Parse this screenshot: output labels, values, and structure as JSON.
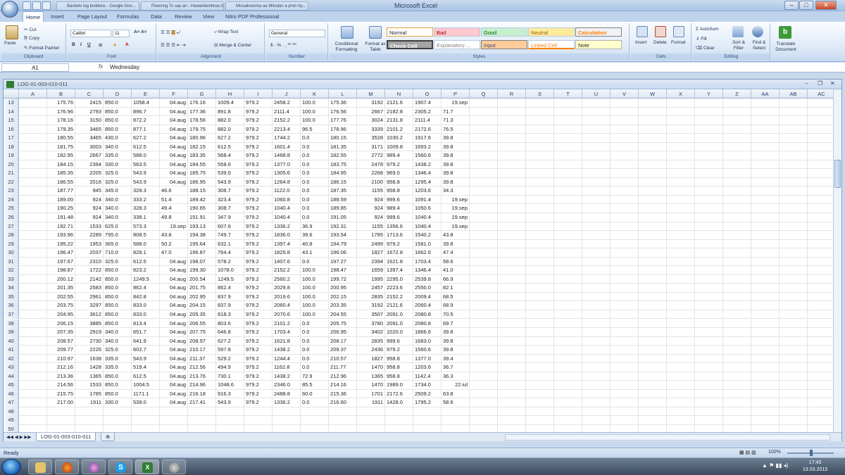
{
  "window": {
    "title": "Microsoft Excel"
  },
  "bg_tabs": [
    "Baskets log buildens - Google Goo...",
    "Planning To say an - Hawaiiskmitnas b...",
    "Mosaikvevina aa Mitodan a pron hp..."
  ],
  "ribbon_tabs": [
    "Home",
    "Insert",
    "Page Layout",
    "Formulas",
    "Data",
    "Review",
    "View",
    "Nitro PDF Professional"
  ],
  "ribbon": {
    "clipboard": {
      "label": "Clipboard",
      "paste": "Paste",
      "cut": "Cut",
      "copy": "Copy",
      "format_painter": "Format Painter"
    },
    "font": {
      "label": "Font",
      "name": "Calibri",
      "size": "11"
    },
    "alignment": {
      "label": "Alignment",
      "wrap": "Wrap Text",
      "merge": "Merge & Center"
    },
    "number": {
      "label": "Number",
      "format": "General"
    },
    "styles": {
      "label": "Styles",
      "conditional": "Conditional Formatting",
      "format_table": "Format as Table",
      "cells": [
        "Normal",
        "Bad",
        "Good",
        "Neutral",
        "Calculation",
        "Check Cell",
        "Explanatory ...",
        "Input",
        "Linked Cell",
        "Note"
      ]
    },
    "cells": {
      "label": "Cells",
      "insert": "Insert",
      "delete": "Delete",
      "format": "Format"
    },
    "editing": {
      "label": "Editing",
      "autosum": "AutoSum",
      "fill": "Fill",
      "clear": "Clear",
      "sort": "Sort & Filter",
      "find": "Find & Select"
    },
    "translate": {
      "label": "Translate Document"
    }
  },
  "formula_bar": {
    "name_box": "A1",
    "fx": "fx",
    "value": "Wednesday"
  },
  "workbook": {
    "title": "LOG-01-003-010-011",
    "sheet_tab": "LOG-01-003-010-011"
  },
  "columns": [
    "A",
    "B",
    "C",
    "D",
    "E",
    "F",
    "G",
    "H",
    "I",
    "J",
    "K",
    "L",
    "M",
    "N",
    "O",
    "P",
    "Q",
    "R",
    "S",
    "T",
    "U",
    "V",
    "W",
    "X",
    "Y",
    "Z",
    "AA",
    "AB",
    "AC"
  ],
  "rows": [
    {
      "n": "13",
      "c": [
        "",
        "175.76",
        "2415",
        "850.0",
        "1058.4",
        "04.aug",
        "176.16",
        "1009.4",
        "979.2",
        "2458.2",
        "100.0",
        "175.36",
        "3192",
        "2121.6",
        "1907.4",
        "19.sep"
      ]
    },
    {
      "n": "14",
      "c": [
        "",
        "176.96",
        "2793",
        "850.0",
        "896.7",
        "04.aug",
        "177.36",
        "891.8",
        "979.2",
        "2111.4",
        "100.0",
        "176.56",
        "2667",
        "2182.8",
        "2305.2",
        "71.7"
      ]
    },
    {
      "n": "15",
      "c": [
        "",
        "178.16",
        "3150",
        "850.0",
        "872.2",
        "04.aug",
        "178.56",
        "882.0",
        "979.2",
        "2152.2",
        "100.0",
        "177.76",
        "3024",
        "2131.8",
        "2111.4",
        "71.3"
      ]
    },
    {
      "n": "16",
      "c": [
        "",
        "179.35",
        "3465",
        "850.0",
        "877.1",
        "04.aug",
        "179.75",
        "882.0",
        "979.2",
        "2213.4",
        "96.5",
        "178.96",
        "3339",
        "2101.2",
        "2172.6",
        "76.5"
      ]
    },
    {
      "n": "17",
      "c": [
        "",
        "180.55",
        "3465",
        "430.0",
        "627.2",
        "04.aug",
        "180.96",
        "627.2",
        "979.2",
        "1744.2",
        "0.0",
        "180.15",
        "3528",
        "1030.2",
        "1917.6",
        "39.8"
      ]
    },
    {
      "n": "18",
      "c": [
        "",
        "181.75",
        "3003",
        "340.0",
        "612.5",
        "04.aug",
        "182.15",
        "612.5",
        "979.2",
        "1601.4",
        "0.0",
        "181.35",
        "3171",
        "1009.8",
        "1693.2",
        "39.8"
      ]
    },
    {
      "n": "19",
      "c": [
        "",
        "182.95",
        "2667",
        "335.0",
        "588.0",
        "04.aug",
        "183.35",
        "568.4",
        "979.2",
        "1468.8",
        "0.0",
        "182.55",
        "2772",
        "989.4",
        "1560.6",
        "39.8"
      ]
    },
    {
      "n": "20",
      "c": [
        "",
        "184.15",
        "2394",
        "330.0",
        "563.5",
        "04.aug",
        "184.55",
        "558.6",
        "979.2",
        "1377.0",
        "0.0",
        "183.75",
        "2478",
        "979.2",
        "1438.2",
        "39.8"
      ]
    },
    {
      "n": "21",
      "c": [
        "",
        "185.35",
        "2205",
        "325.0",
        "543.9",
        "04.aug",
        "185.75",
        "539.0",
        "979.2",
        "1305.6",
        "0.0",
        "184.95",
        "2268",
        "969.0",
        "1346.4",
        "39.8"
      ]
    },
    {
      "n": "22",
      "c": [
        "",
        "186.55",
        "2016",
        "325.0",
        "543.9",
        "04.aug",
        "186.95",
        "543.9",
        "979.2",
        "1264.8",
        "0.0",
        "186.15",
        "2100",
        "958.8",
        "1295.4",
        "39.8"
      ]
    },
    {
      "n": "23",
      "c": [
        "",
        "187.77",
        "945",
        "345.0",
        "328.3",
        "46.6",
        "188.15",
        "308.7",
        "979.2",
        "1122.0",
        "0.0",
        "187.35",
        "1155",
        "958.8",
        "1203.6",
        "34.3"
      ]
    },
    {
      "n": "24",
      "c": [
        "",
        "189.00",
        "924",
        "340.0",
        "333.2",
        "51.4",
        "189.42",
        "323.4",
        "979.2",
        "1060.8",
        "0.0",
        "188.59",
        "924",
        "999.6",
        "1091.4",
        "19.sep"
      ]
    },
    {
      "n": "25",
      "c": [
        "",
        "190.25",
        "924",
        "340.0",
        "328.3",
        "49.4",
        "190.65",
        "308.7",
        "979.2",
        "1040.4",
        "0.0",
        "189.85",
        "924",
        "989.4",
        "1050.6",
        "19.sep"
      ]
    },
    {
      "n": "26",
      "c": [
        "",
        "191.48",
        "924",
        "340.0",
        "338.1",
        "49.8",
        "191.91",
        "347.9",
        "979.2",
        "1040.4",
        "0.0",
        "191.05",
        "924",
        "999.6",
        "1040.4",
        "19.sep"
      ]
    },
    {
      "n": "27",
      "c": [
        "",
        "192.71",
        "1533",
        "625.0",
        "573.3",
        "19.sep",
        "193.13",
        "607.6",
        "979.2",
        "1336.2",
        "36.9",
        "192.31",
        "1155",
        "1356.6",
        "1040.4",
        "19.sep"
      ]
    },
    {
      "n": "28",
      "c": [
        "",
        "193.96",
        "2289",
        "795.0",
        "808.5",
        "43.8",
        "194.38",
        "749.7",
        "979.2",
        "1836.0",
        "39.6",
        "193.54",
        "1785",
        "1713.6",
        "1540.2",
        "43.8"
      ]
    },
    {
      "n": "29",
      "c": [
        "",
        "195.22",
        "1953",
        "365.0",
        "588.0",
        "50.2",
        "195.64",
        "632.1",
        "979.2",
        "1397.4",
        "40.8",
        "194.79",
        "2499",
        "979.2",
        "1581.0",
        "39.8"
      ]
    },
    {
      "n": "30",
      "c": [
        "",
        "196.47",
        "2037",
        "710.0",
        "828.1",
        "47.0",
        "196.87",
        "764.4",
        "979.2",
        "1825.8",
        "43.1",
        "196.06",
        "1827",
        "1672.8",
        "1662.6",
        "47.4"
      ]
    },
    {
      "n": "31",
      "c": [
        "",
        "197.67",
        "2310",
        "325.0",
        "612.5",
        "04.aug",
        "198.07",
        "578.2",
        "979.2",
        "1407.6",
        "0.0",
        "197.27",
        "2394",
        "1621.8",
        "1703.4",
        "58.6"
      ]
    },
    {
      "n": "32",
      "c": [
        "",
        "198.87",
        "1722",
        "850.0",
        "823.2",
        "04.aug",
        "199.30",
        "1078.0",
        "979.2",
        "2152.2",
        "100.0",
        "198.47",
        "1659",
        "1397.4",
        "1346.4",
        "41.0"
      ]
    },
    {
      "n": "33",
      "c": [
        "",
        "200.12",
        "2142",
        "850.0",
        "1249.5",
        "04.aug",
        "200.54",
        "1249.5",
        "979.2",
        "2560.2",
        "100.0",
        "199.72",
        "1995",
        "2295.0",
        "2539.8",
        "66.9"
      ]
    },
    {
      "n": "34",
      "c": [
        "",
        "201.35",
        "2583",
        "850.0",
        "862.4",
        "04.aug",
        "201.75",
        "862.4",
        "979.2",
        "2029.8",
        "100.0",
        "200.95",
        "2457",
        "2223.6",
        "2550.0",
        "82.1"
      ]
    },
    {
      "n": "35",
      "c": [
        "",
        "202.55",
        "2961",
        "850.0",
        "842.8",
        "04.aug",
        "202.95",
        "837.9",
        "979.2",
        "2019.6",
        "100.0",
        "202.15",
        "2835",
        "2152.2",
        "2009.4",
        "68.5"
      ]
    },
    {
      "n": "36",
      "c": [
        "",
        "203.75",
        "3297",
        "850.0",
        "833.0",
        "04.aug",
        "204.15",
        "837.9",
        "979.2",
        "2060.4",
        "100.0",
        "203.35",
        "3192",
        "2121.6",
        "2060.4",
        "68.9"
      ]
    },
    {
      "n": "37",
      "c": [
        "",
        "204.95",
        "3612",
        "850.0",
        "833.0",
        "04.aug",
        "205.35",
        "818.3",
        "979.2",
        "2070.6",
        "100.0",
        "204.55",
        "3507",
        "2091.0",
        "2080.8",
        "70.5"
      ]
    },
    {
      "n": "38",
      "c": [
        "",
        "206.15",
        "3885",
        "850.0",
        "813.4",
        "04.aug",
        "206.55",
        "803.6",
        "979.2",
        "2101.2",
        "0.0",
        "205.75",
        "3780",
        "2091.0",
        "2080.8",
        "69.7"
      ]
    },
    {
      "n": "39",
      "c": [
        "",
        "207.35",
        "2919",
        "340.0",
        "651.7",
        "04.aug",
        "207.75",
        "646.8",
        "979.2",
        "1703.4",
        "0.0",
        "206.95",
        "3402",
        "1020.0",
        "1866.6",
        "39.8"
      ]
    },
    {
      "n": "40",
      "c": [
        "",
        "208.57",
        "2730",
        "340.0",
        "641.9",
        "04.aug",
        "208.97",
        "627.2",
        "979.2",
        "1621.8",
        "0.0",
        "208.17",
        "2835",
        "999.6",
        "1683.0",
        "39.8"
      ]
    },
    {
      "n": "41",
      "c": [
        "",
        "209.77",
        "2226",
        "325.0",
        "602.7",
        "04.aug",
        "210.17",
        "597.8",
        "979.2",
        "1438.2",
        "0.0",
        "209.37",
        "2436",
        "979.2",
        "1560.6",
        "39.8"
      ]
    },
    {
      "n": "42",
      "c": [
        "",
        "210.97",
        "1638",
        "335.0",
        "543.9",
        "04.aug",
        "211.37",
        "529.2",
        "979.2",
        "1244.4",
        "0.0",
        "210.57",
        "1827",
        "958.8",
        "1377.0",
        "39.4"
      ]
    },
    {
      "n": "43",
      "c": [
        "",
        "212.16",
        "1428",
        "335.0",
        "519.4",
        "04.aug",
        "212.56",
        "494.9",
        "979.2",
        "1162.8",
        "0.0",
        "211.77",
        "1470",
        "958.8",
        "1203.6",
        "36.7"
      ]
    },
    {
      "n": "44",
      "c": [
        "",
        "213.36",
        "1365",
        "850.0",
        "612.5",
        "04.aug",
        "213.76",
        "730.1",
        "979.2",
        "1438.2",
        "72.9",
        "212.96",
        "1365",
        "958.8",
        "1142.4",
        "36.3"
      ]
    },
    {
      "n": "45",
      "c": [
        "",
        "214.56",
        "1533",
        "850.0",
        "1004.5",
        "04.aug",
        "214.96",
        "1048.6",
        "979.2",
        "2346.0",
        "85.5",
        "214.16",
        "1470",
        "1989.0",
        "1734.0",
        "22.iul"
      ]
    },
    {
      "n": "46",
      "c": [
        "",
        "215.75",
        "1785",
        "850.0",
        "1171.1",
        "04.aug",
        "216.18",
        "916.3",
        "979.2",
        "2488.8",
        "60.0",
        "215.36",
        "1701",
        "2172.6",
        "2509.2",
        "63.8"
      ]
    },
    {
      "n": "47",
      "c": [
        "",
        "217.00",
        "1911",
        "330.0",
        "539.0",
        "04.aug",
        "217.41",
        "543.9",
        "979.2",
        "1336.2",
        "0.0",
        "216.60",
        "1911",
        "1428.0",
        "1795.2",
        "58.6"
      ]
    },
    {
      "n": "48",
      "c": []
    },
    {
      "n": "49",
      "c": []
    },
    {
      "n": "50",
      "c": []
    }
  ],
  "status": {
    "ready": "Ready",
    "zoom": "100%"
  },
  "clock": {
    "time": "17:43",
    "date": "13.03.2013"
  }
}
